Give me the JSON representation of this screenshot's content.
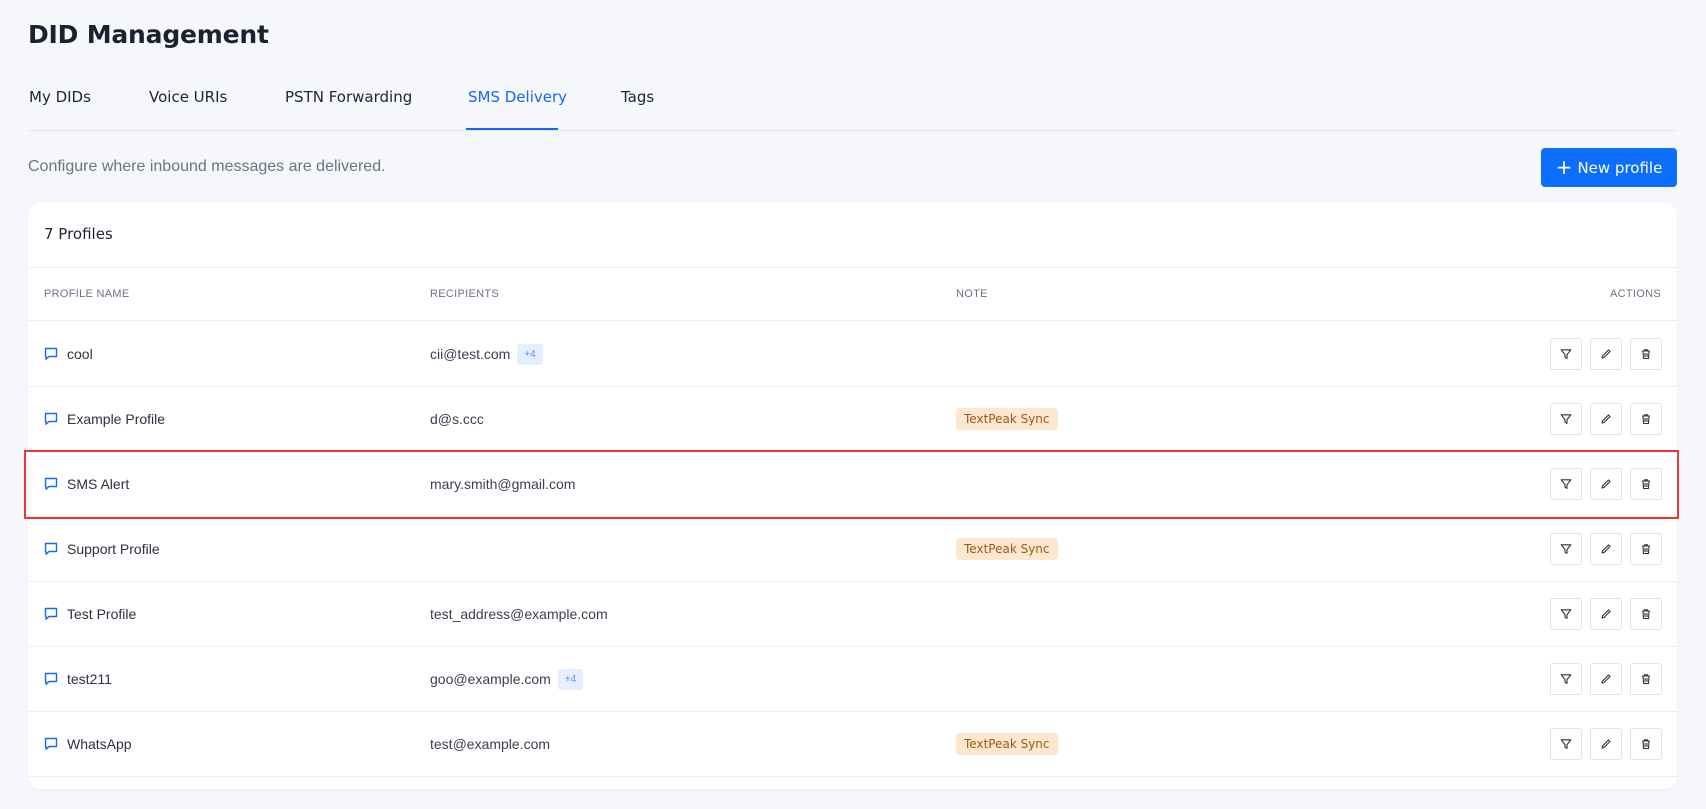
{
  "page": {
    "title": "DID Management",
    "subtitle": "Configure where inbound messages are delivered."
  },
  "tabs": [
    {
      "label": "My DIDs",
      "active": false
    },
    {
      "label": "Voice URIs",
      "active": false
    },
    {
      "label": "PSTN Forwarding",
      "active": false
    },
    {
      "label": "SMS Delivery",
      "active": true
    },
    {
      "label": "Tags",
      "active": false
    }
  ],
  "toolbar": {
    "new_profile_label": "New profile"
  },
  "table": {
    "count_label": "7 Profiles",
    "columns": {
      "name": "PROFILE NAME",
      "recipients": "RECIPIENTS",
      "note": "NOTE",
      "actions": "ACTIONS"
    },
    "rows": [
      {
        "name": "cool",
        "recipient": "cii@test.com",
        "extra": "+4",
        "note": "",
        "highlighted": false
      },
      {
        "name": "Example Profile",
        "recipient": "d@s.ccc",
        "extra": "",
        "note": "TextPeak Sync",
        "highlighted": false
      },
      {
        "name": "SMS Alert",
        "recipient": "mary.smith@gmail.com",
        "extra": "",
        "note": "",
        "highlighted": true
      },
      {
        "name": "Support Profile",
        "recipient": "",
        "extra": "",
        "note": "TextPeak Sync",
        "highlighted": false
      },
      {
        "name": "Test Profile",
        "recipient": "test_address@example.com",
        "extra": "",
        "note": "",
        "highlighted": false
      },
      {
        "name": "test211",
        "recipient": "goo@example.com",
        "extra": "+4",
        "note": "",
        "highlighted": false
      },
      {
        "name": "WhatsApp",
        "recipient": "test@example.com",
        "extra": "",
        "note": "TextPeak Sync",
        "highlighted": false
      }
    ]
  },
  "icons": {
    "row_icon": "chat-bubble-icon",
    "actions": [
      "filter-icon",
      "pencil-icon",
      "trash-icon"
    ]
  },
  "colors": {
    "accent": "#0d6efd",
    "active_tab": "#1768f0",
    "highlight_border": "#e53935",
    "note_badge_bg": "#fde7cf",
    "note_badge_text": "#9a5a1a"
  }
}
